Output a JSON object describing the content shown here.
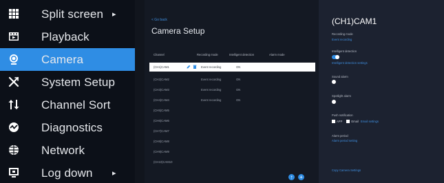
{
  "menu": {
    "items": [
      {
        "label": "Split screen",
        "icon": "grid-icon",
        "arrow": "▸"
      },
      {
        "label": "Playback",
        "icon": "film-icon"
      },
      {
        "label": "Camera",
        "icon": "camera-icon"
      },
      {
        "label": "System Setup",
        "icon": "tools-icon"
      },
      {
        "label": "Channel Sort",
        "icon": "sort-icon"
      },
      {
        "label": "Diagnostics",
        "icon": "diagnostics-icon"
      },
      {
        "label": "Network",
        "icon": "globe-icon"
      },
      {
        "label": "Log down",
        "icon": "monitor-icon",
        "arrow": "▸"
      }
    ],
    "active": "Camera"
  },
  "center": {
    "back_link": "< Go back",
    "title": "Camera Setup",
    "columns": [
      "Channel",
      "Recording mode",
      "Intelligent detection",
      "Alarm mode"
    ],
    "rows": [
      {
        "channel": "(CH1)CAM1",
        "recording": "Event recording",
        "detection": "ON"
      },
      {
        "channel": "(CH2)CAM2",
        "recording": "Event recording",
        "detection": "ON"
      },
      {
        "channel": "(CH3)CAM3",
        "recording": "Event recording",
        "detection": "ON"
      },
      {
        "channel": "(CH4)CAM4",
        "recording": "Event recording",
        "detection": "ON"
      },
      {
        "channel": "(CH5)CAM5"
      },
      {
        "channel": "(CH6)CAM6"
      },
      {
        "channel": "(CH7)CAM7"
      },
      {
        "channel": "(CH8)CAM8"
      },
      {
        "channel": "(CH9)CAM9"
      },
      {
        "channel": "(CH10)CAM10"
      }
    ],
    "selected_row": 0,
    "fab_icons": [
      "upload-icon",
      "add-icon"
    ]
  },
  "detail": {
    "title": "(CH1)CAM1",
    "recording_mode_label": "Recording mode",
    "recording_mode_value": "Event recording",
    "intelligent_detection_label": "Intelligent detection",
    "intelligent_detection_on": true,
    "intelligent_detection_settings": "Intelligent detection settings",
    "sound_alarm_label": "Sound alarm",
    "sound_alarm_on": false,
    "spotlight_alarm_label": "Spotlight alarm",
    "spotlight_alarm_on": false,
    "push_notification_label": "Push notification",
    "push_app": "APP",
    "push_email": "Email",
    "email_settings": "Email settings",
    "alarm_period_label": "Alarm period",
    "alarm_period_value": "Alarm period setting",
    "copy_camera_settings": "Copy Camera Settings"
  },
  "colors": {
    "accent": "#2f8de4",
    "menu_bg": "#0c1018",
    "center_bg": "#141923",
    "right_bg": "#1c2230"
  }
}
